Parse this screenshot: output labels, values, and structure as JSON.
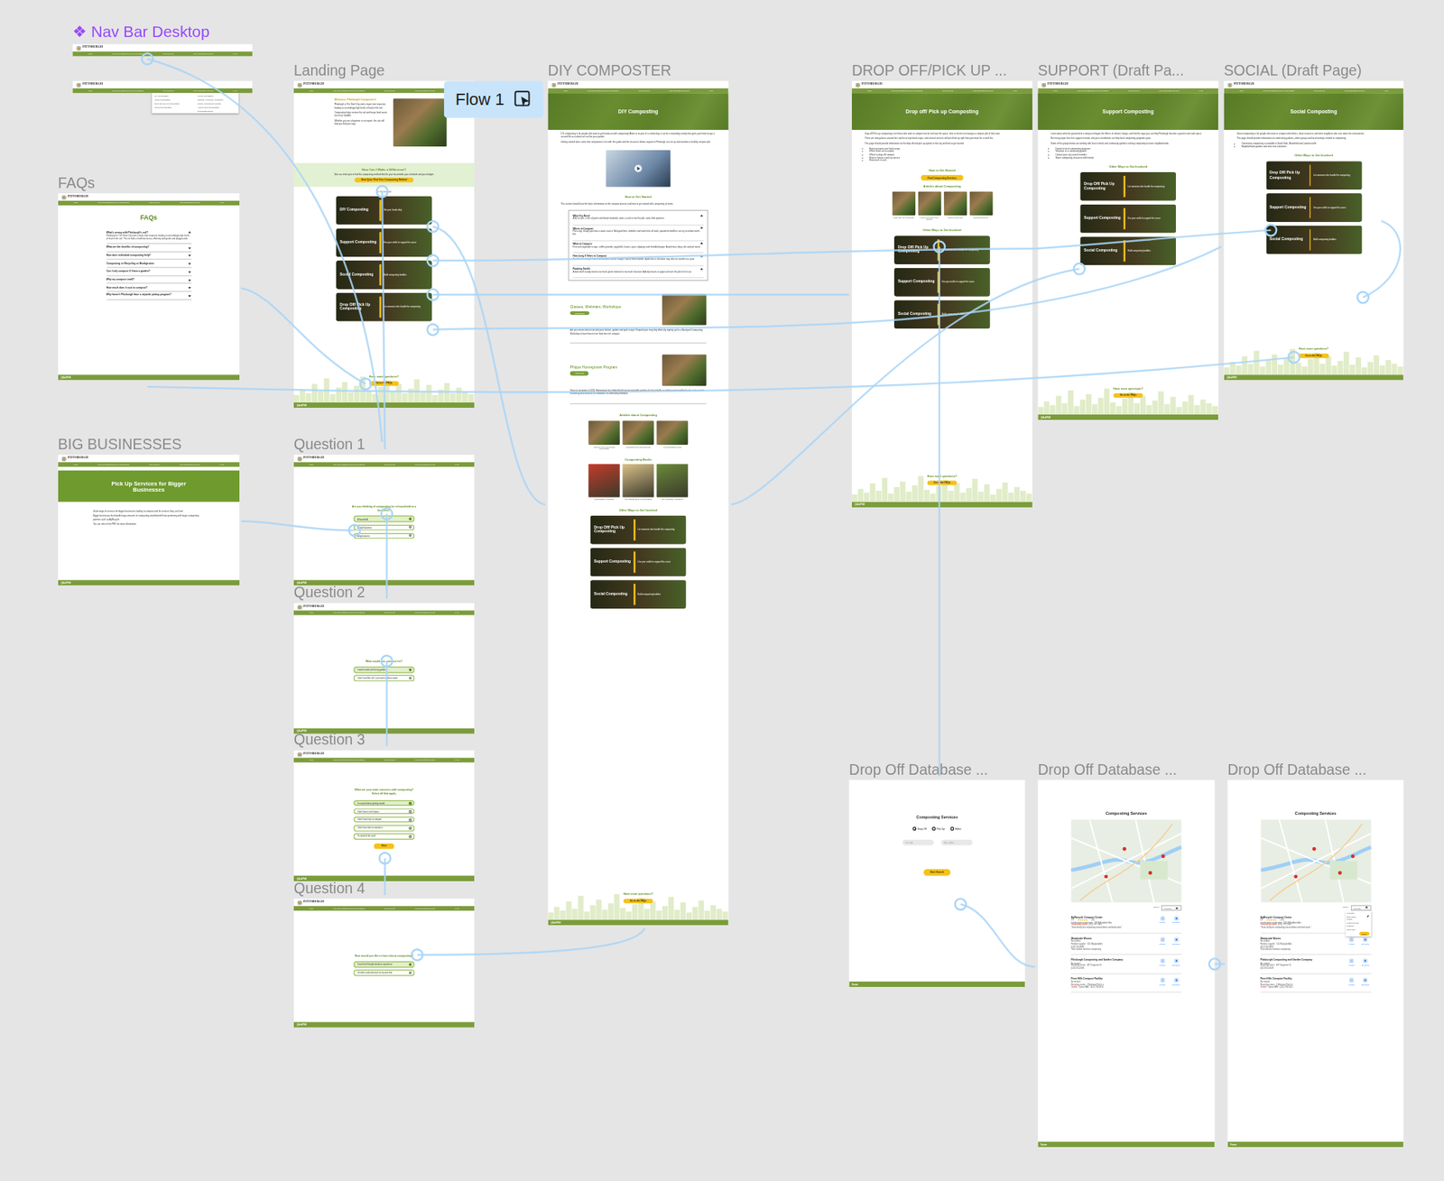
{
  "component": {
    "icon": "❖",
    "label": "Nav Bar Desktop"
  },
  "flow": {
    "label": "Flow 1"
  },
  "nav": {
    "logo": "PITTSBURGH",
    "items": [
      "Home",
      "Why Does Pittsburgh Need Composting?",
      "Get Involved ▾",
      "Find Composting Services",
      "FAQs"
    ]
  },
  "navbar_menu": {
    "open": true,
    "columns": [
      [
        "DIY Composting",
        "Social Composting",
        "Drop Off/ Pick Up Composting",
        "Support Composting"
      ],
      [
        "How to Get Started",
        "Classes, Webinars, Workshops",
        "Phipps Homegrown Program",
        "Articles about Composting",
        "Composting Books"
      ]
    ]
  },
  "footer": "@AskPGH",
  "more": {
    "title": "Have more questions?",
    "button": "Go to the FAQs"
  },
  "ways_heading": "Other Ways to Get Involved",
  "ways": [
    {
      "title": "DIY Composting",
      "desc": "Get your hands dirty"
    },
    {
      "title": "Support Composting",
      "desc": "Use your wallet to support the cause"
    },
    {
      "title": "Social Composting",
      "desc": "Build composting buddies"
    },
    {
      "title": "Drop Off/ Pick Up Composting",
      "desc": "Let someone else handle the composting"
    }
  ],
  "frames": [
    {
      "label": "FAQs",
      "kind": "faqs",
      "title": "FAQs",
      "items": [
        {
          "q": "What's wrong with Pittsburgh's soil?",
          "expanded": true,
          "a": "Pittsburgh is The Steel City and a major train inspector leading to exceedingly high levels of lead in the soil. This includes residential areas, affecting backyards and playgrounds."
        },
        {
          "q": "What are the benefits of composting?",
          "expanded": false
        },
        {
          "q": "How does individual composting help?",
          "expanded": false
        },
        {
          "q": "Composting vs Recycling vs Biodigestion",
          "expanded": false
        },
        {
          "q": "Can I only compost if I have a garden?",
          "expanded": false
        },
        {
          "q": "Why my compost smell?",
          "expanded": false
        },
        {
          "q": "How much does it cost to compost?",
          "expanded": false
        },
        {
          "q": "Why haven't Pittsburgh have a citywide pickup program?",
          "expanded": false
        }
      ]
    },
    {
      "label": "BIG BUSINESSES",
      "kind": "business",
      "title": "Pick Up Services for Bigger Businesses",
      "paragraphs": [
        "Good range of services for bigger businesses looking to compost and for services they can fund.",
        "Bigger businesses that handle large amounts of composting would benefit from partnering with larger composting partners such as AgRecycle.",
        "You can refer to the PRC for more information."
      ]
    },
    {
      "label": "Landing Page",
      "kind": "landing",
      "intro": {
        "title": "Welcome, Pittsburgh Composters!",
        "paragraphs": [
          "Pittsburgh is The Steel City and a major train inspector, leading to exceedingly high levels of lead in the soil.",
          "Composting helps restore the soil and keeps food waste out of our landfills.",
          "Whether you are a beginner or an expert, this site will help you find your way."
        ]
      },
      "band": {
        "title": "How Can I Make a Difference?",
        "text": "Take our short quiz to find the composting method that fits your household, your schedule and your budget.",
        "button": "Start Quiz: Find Your Composting Method"
      },
      "get_involved": "Or Get Involved",
      "ways": [
        0,
        1,
        2,
        3
      ]
    },
    {
      "label": "Question 1",
      "kind": "question",
      "multi": false,
      "question": "Are you thinking of composting for a household or a business?",
      "options": [
        {
          "text": "A household",
          "selected": true
        },
        {
          "text": "A small business",
          "selected": false
        },
        {
          "text": "A big business",
          "selected": false
        }
      ]
    },
    {
      "label": "Question 2",
      "kind": "question",
      "multi": false,
      "question": "What would you compost for?",
      "options": [
        {
          "text": "I want to make soil for my garden",
          "selected": true
        },
        {
          "text": "I don't need the soil, I just want to reduce waste",
          "selected": false
        }
      ]
    },
    {
      "label": "Question 3",
      "kind": "question",
      "multi": true,
      "question": "What are your main concerns with composting? Select all that apply.",
      "options": [
        {
          "text": "I'm worried about getting started",
          "selected": true
        },
        {
          "text": "I don't have a lot of space",
          "selected": false
        },
        {
          "text": "I don't know how to compost",
          "selected": false
        },
        {
          "text": "I don't have time to maintain it",
          "selected": false
        },
        {
          "text": "I'm afraid of the smell",
          "selected": false
        }
      ],
      "button": "Next"
    },
    {
      "label": "Question 4",
      "kind": "question",
      "multi": false,
      "question": "How would you like to learn about composting?",
      "options": [
        {
          "text": "I learn best through hands-on experience",
          "selected": true
        },
        {
          "text": "I'd rather read and watch on my own time",
          "selected": false
        }
      ]
    },
    {
      "label": "DIY COMPOSTER",
      "kind": "diy",
      "hero": "DIY Composting",
      "paragraphs": [
        "DIY composting is for people who want to get hands-on with composting! Alone or as part of a community, it can be a rewarding activity that gives your food scraps a second life as nutrient-rich soil for your garden.",
        "Getting started takes some time and patience, but with this guide and the resources below, anyone in Pittsburgh can set up and maintain a healthy compost pile."
      ],
      "get_started": {
        "title": "How to Get Started",
        "text": "This section should have the basic information on the compost process and how to get started with composting at home."
      },
      "sections": [
        {
          "title": "What You Need",
          "expanded": true,
          "text": "A bin or pile, a mix of green and brown materials, water, a tool to turn the pile, and a little patience."
        },
        {
          "title": "Where to Compost",
          "expanded": true,
          "text": "Pick a dry, shady spot near a water source. Backyard bins, tumblers and worm bins all work; apartment dwellers can try an indoor worm bin."
        },
        {
          "title": "What to Compost",
          "expanded": true,
          "text": "Fruit and vegetable scraps, coffee grounds, eggshells, leaves, grass clippings and shredded paper. Avoid meat, dairy, oils and pet waste."
        },
        {
          "title": "How Long It Takes to Compost",
          "expanded": true,
          "text": "A well-balanced pile that is turned often can be ready in two to three months. A pile that is left alone may take six months to a year."
        },
        {
          "title": "Rotating Smells",
          "expanded": true,
          "text": "A bad smell usually means too much green material or too much moisture. Add dry leaves or paper and turn the pile to let in air."
        }
      ],
      "events": [
        {
          "title": "Classes, Webinars, Workshops",
          "button": "Learn More",
          "text": "Are you unsure what to do with your kitchen, garden and yard scraps? Expand your recycling efforts by signing up for a Backyard Composting Workshop to learn how to turn food into rich compost."
        },
        {
          "title": "Phipps Homegrown Program",
          "button": "Apply Now",
          "text": "Since its inception in 2013, Homegrown has helped build raised vegetable gardens for households in underserved neighborhoods and provided mentoring and resources to hundreds of community members."
        }
      ],
      "articles": {
        "title": "Articles about Composting",
        "items": [
          "Where to get Food Scraps Composting",
          "Great Backyard Compost Tips",
          "10 Composting Myths"
        ]
      },
      "books": {
        "title": "Composting Books",
        "items": [
          "Worms Eat My Garbage",
          "The Sibbald Book of Composting",
          "The Humanure Handbook"
        ]
      },
      "ways": [
        3,
        1,
        2
      ]
    },
    {
      "label": "DROP OFF/PICK UP ...",
      "kind": "page",
      "hero": "Drop off/ Pick up Composting",
      "paragraphs": [
        "Drop off/ Pick up composting is for those who want to compost but do not have the space, time or interest to manage a compost pile of their own.",
        "There are many places around the city that accept food scraps, and several services will pick them up right from your door for a small fee.",
        "This page should provide information on the drop off and pick up options in the city and how to get started."
      ],
      "bullets": [
        "How to prepare your food scraps",
        "Which items are accepted",
        "Where to drop off compost",
        "How to choose a pick up service",
        "How much it costs"
      ],
      "get_started": {
        "title": "How to Get Started",
        "button": "Find Composting Services"
      },
      "articles": {
        "title": "Articles about Composting",
        "items": [
          "What Can You Compost?",
          "How to Compost Food Scraps",
          "Where to Drop Off",
          "Compost Bins 101"
        ]
      },
      "ways": [
        3,
        1,
        2
      ]
    },
    {
      "label": "SUPPORT  (Draft Pa...",
      "kind": "page",
      "hero": "Support Composting",
      "paragraphs": [
        "Learn about what the government is doing to mitigate the effects of climate change, and find the ways you can help Pittsburgh become a greener and safer place.",
        "Not every project has the support it needs, and your contribution can help local composting programs grow.",
        "Some of the groups below are working with local schools and community gardens to bring composting to more neighborhoods."
      ],
      "bullets": [
        "Donate to local composting programs",
        "Volunteer at a community garden",
        "Contact your city council member",
        "Share composting resources with friends"
      ],
      "ways": [
        3,
        1,
        2
      ]
    },
    {
      "label": "SOCIAL  (Draft Page)",
      "kind": "page",
      "hero": "Social Composting",
      "paragraphs": [
        "Social composting is for people who want to compost with others, share resources and meet neighbors who care about the environment.",
        "This page should provide information on community gardens, online groups and local meetups related to composting."
      ],
      "bullets": [
        "Community composting is available in South Side, Bloomfield and Lawrenceville",
        "Neighborhood gardens welcome new volunteers"
      ],
      "ways": [
        3,
        1,
        2
      ]
    },
    {
      "label": "Drop Off Database ...",
      "kind": "db-search",
      "title": "Composting Services",
      "options": [
        {
          "text": "Drop Off",
          "selected": true
        },
        {
          "text": "Pick Up",
          "selected": false
        },
        {
          "text": "Either",
          "selected": false
        }
      ],
      "fields": [
        "Zip Code",
        "Max. radius"
      ],
      "button": "Start Search",
      "footer": "Footer"
    },
    {
      "label": "Drop Off Database ...",
      "kind": "db-results",
      "title": "Composting Services",
      "sort": {
        "label": "Sort by",
        "value": "Proximity",
        "open": false
      },
      "actions": [
        "Website",
        "Directions"
      ],
      "results": [
        {
          "name": "AgRecycle Compost Center",
          "rating": "4.5",
          "stars": 4.5,
          "reviews": "(24)",
          "details": "Landscaping supply store · 335 N Braddock Ave",
          "status": "Temporarily closed",
          "closed": true,
          "phone": "· (412) 767-7845",
          "note": "\"Great facility for composting natural debris and food waste.\""
        },
        {
          "name": "Shadyside Worms",
          "reviews": "No reviews",
          "details": "Fertilizer supplier · 510 Maryland Ave",
          "phone": "(412) 532-6896",
          "note": "Their website mentions composting"
        },
        {
          "name": "Pittsburgh Composting and Garden Company",
          "reviews": "No reviews",
          "details": "Recycling center · 487 Duquesne Dr",
          "phone": "(412) 651-6328"
        },
        {
          "name": "Penn Hills Compost Facility",
          "reviews": "No reviews",
          "details": "Recycling center · 2 Memorial Park Ln",
          "status": "Closed",
          "closed": true,
          "phone": "· Opens 8AM · (412) 798-3151"
        }
      ],
      "footer": "Footer"
    },
    {
      "label": "Drop Off Database ...",
      "kind": "db-results",
      "title": "Composting Services",
      "sort": {
        "label": "Sort by",
        "value": "Proximity",
        "open": true,
        "menu": [
          {
            "text": "Proximity",
            "selected": false
          },
          {
            "text": "Best match",
            "selected": true
          },
          {
            "text": "Rating",
            "selected": false
          },
          {
            "text": "Most reviewed",
            "selected": false
          },
          {
            "text": "Distance",
            "selected": false
          },
          {
            "text": "Open now",
            "selected": false
          }
        ],
        "button": "Done"
      },
      "actions": [
        "Website",
        "Directions"
      ],
      "results": [
        {
          "name": "AgRecycle Compost Center",
          "rating": "4.5",
          "stars": 4.5,
          "reviews": "(24)",
          "details": "Landscaping supply store · 335 N Braddock Ave",
          "status": "Temporarily closed",
          "closed": true,
          "phone": "· (412) 767-7845",
          "note": "\"Great facility for composting natural debris and food waste.\""
        },
        {
          "name": "Shadyside Worms",
          "reviews": "No reviews",
          "details": "Fertilizer supplier · 510 Maryland Ave",
          "phone": "(412) 532-6896",
          "note": "Their website mentions composting"
        },
        {
          "name": "Pittsburgh Composting and Garden Company",
          "reviews": "No reviews",
          "details": "Recycling center · 487 Duquesne Dr",
          "phone": "(412) 651-6328"
        },
        {
          "name": "Penn Hills Compost Facility",
          "reviews": "No reviews",
          "details": "Recycling center · 2 Memorial Park Ln",
          "status": "Closed",
          "closed": true,
          "phone": "· Opens 8AM · (412) 798-3151"
        }
      ],
      "footer": "Footer"
    }
  ]
}
